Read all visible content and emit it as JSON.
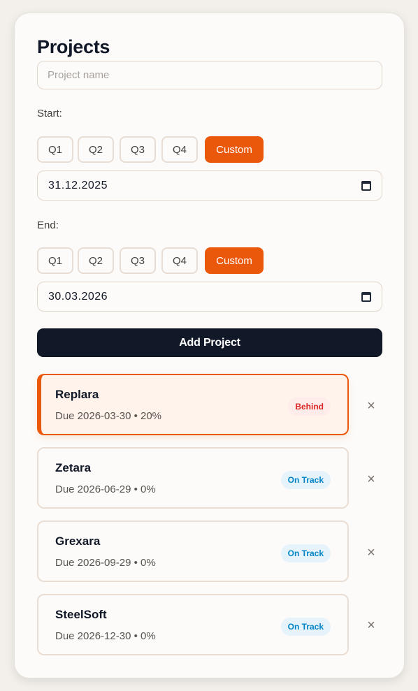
{
  "title": "Projects",
  "name_input": {
    "placeholder": "Project name",
    "value": ""
  },
  "start": {
    "label": "Start:",
    "quarters": [
      "Q1",
      "Q2",
      "Q3",
      "Q4"
    ],
    "custom_label": "Custom",
    "selected": "Custom",
    "date": "31.12.2025"
  },
  "end": {
    "label": "End:",
    "quarters": [
      "Q1",
      "Q2",
      "Q3",
      "Q4"
    ],
    "custom_label": "Custom",
    "selected": "Custom",
    "date": "30.03.2026"
  },
  "add_button": "Add Project",
  "projects": [
    {
      "name": "Replara",
      "meta": "Due 2026-03-30 • 20%",
      "status": "Behind",
      "progress_percent": 20,
      "active": true
    },
    {
      "name": "Zetara",
      "meta": "Due 2026-06-29 • 0%",
      "status": "On Track",
      "progress_percent": 0,
      "active": false
    },
    {
      "name": "Grexara",
      "meta": "Due 2026-09-29 • 0%",
      "status": "On Track",
      "progress_percent": 0,
      "active": false
    },
    {
      "name": "SteelSoft",
      "meta": "Due 2026-12-30 • 0%",
      "status": "On Track",
      "progress_percent": 0,
      "active": false
    }
  ],
  "remove_icon": "×",
  "colors": {
    "accent": "#ea580c",
    "primary_dark": "#111827",
    "behind": "#dc2626",
    "on_track": "#0284c7"
  }
}
